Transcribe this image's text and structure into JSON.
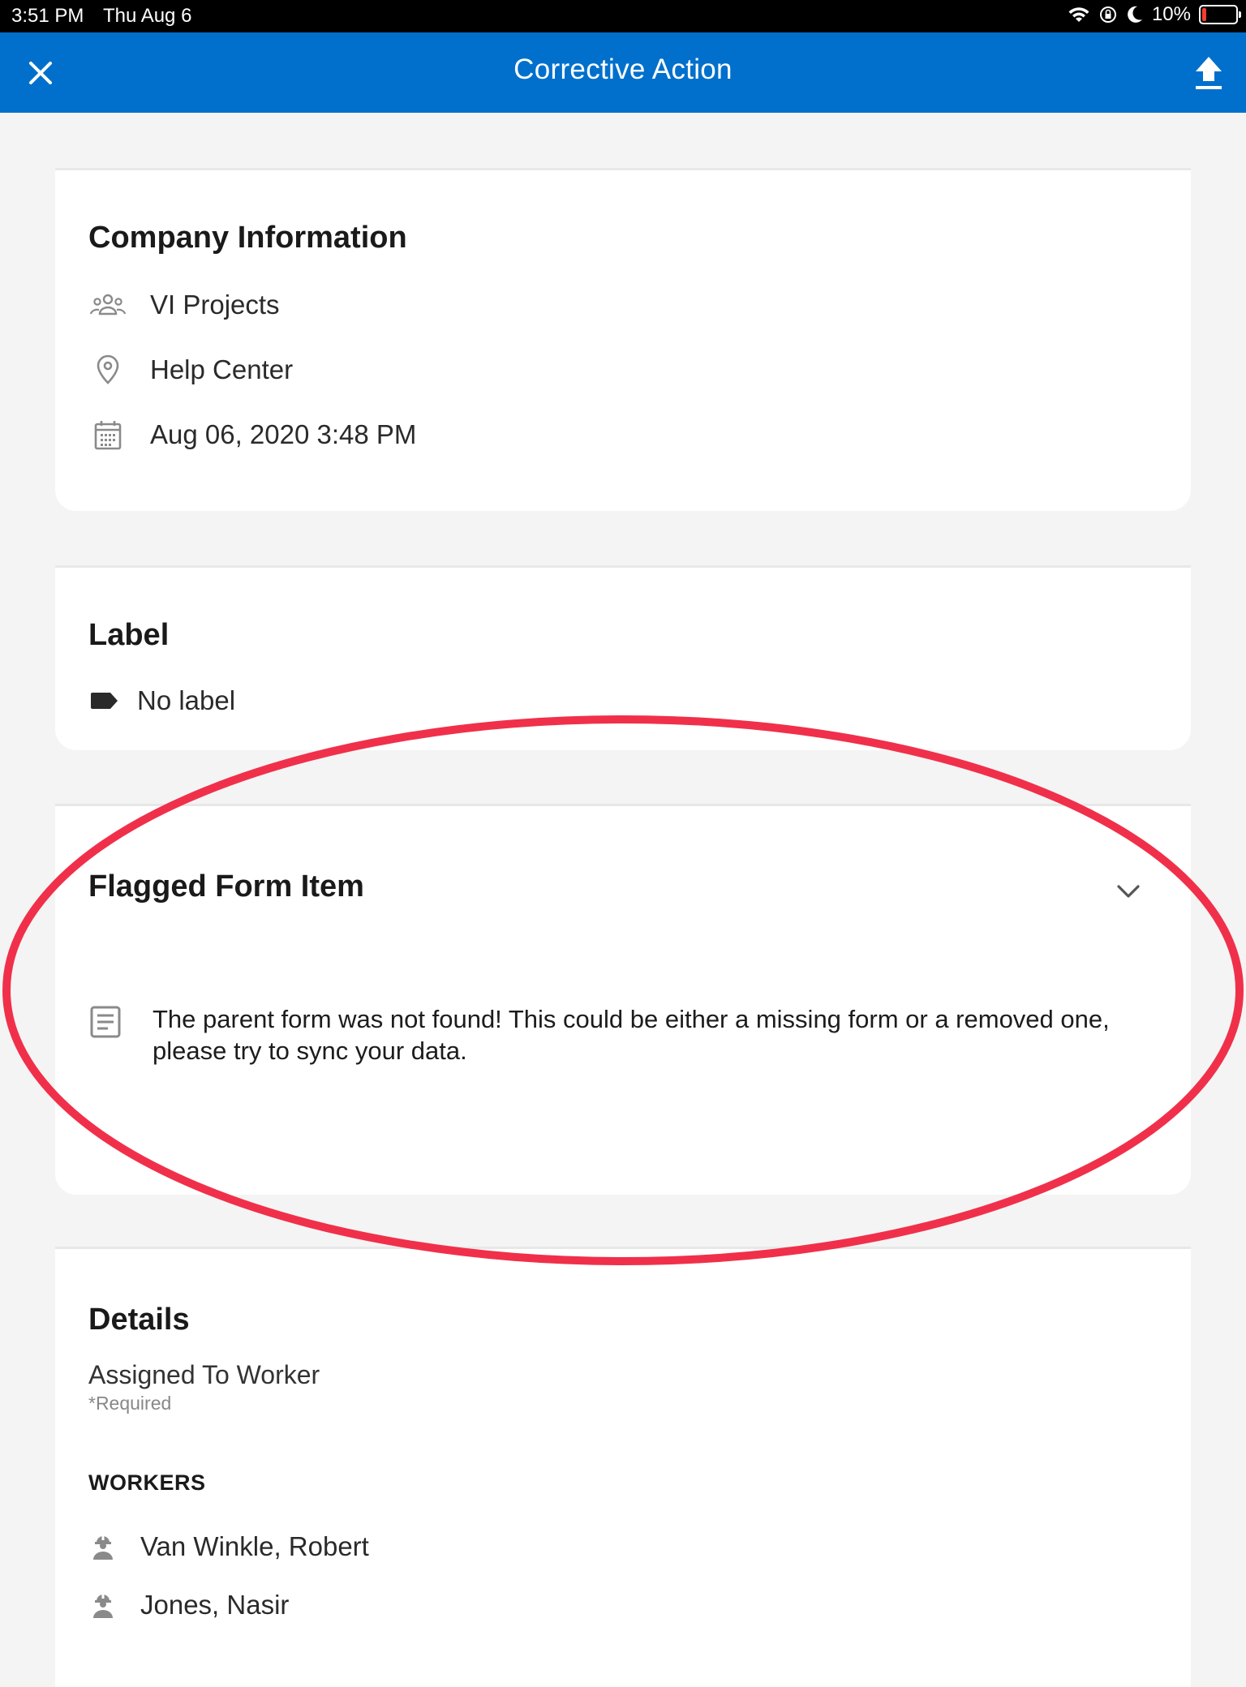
{
  "status_bar": {
    "time": "3:51 PM",
    "date": "Thu Aug 6",
    "battery": "10%",
    "battery_level": 0.1,
    "icons": [
      "wifi-icon",
      "orientation-lock-icon",
      "moon-icon",
      "battery-icon"
    ]
  },
  "nav": {
    "title": "Corrective Action",
    "left_icon": "close-icon",
    "right_icon": "upload-icon",
    "color": "#0070cc"
  },
  "company_info": {
    "heading": "Company Information",
    "project": "VI Projects",
    "location": "Help Center",
    "datetime": "Aug 06, 2020 3:48 PM"
  },
  "label_section": {
    "heading": "Label",
    "value": "No label"
  },
  "flagged": {
    "heading": "Flagged Form Item",
    "message": "The parent form was not found! This could be either a missing form or a removed one, please try to sync your data."
  },
  "details": {
    "heading": "Details",
    "assigned_label": "Assigned To Worker",
    "required_text": "*Required",
    "workers_heading": "WORKERS",
    "workers": [
      "Van Winkle, Robert",
      "Jones, Nasir"
    ]
  },
  "annotation_color": "#f0304a"
}
